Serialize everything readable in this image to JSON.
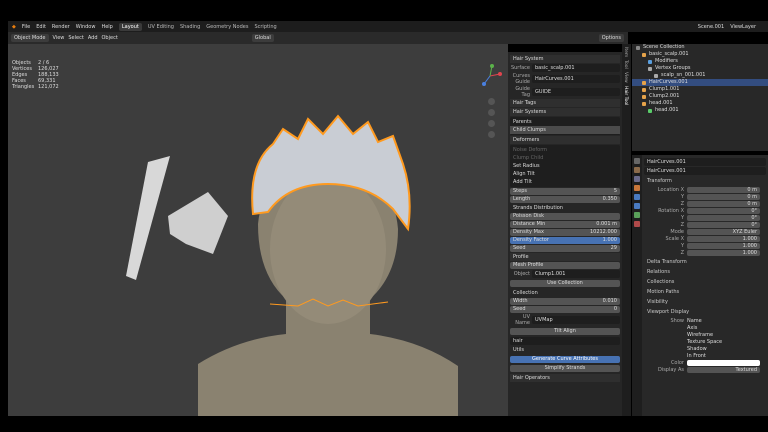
{
  "topbar": {
    "menus": [
      "File",
      "Edit",
      "Render",
      "Window",
      "Help"
    ],
    "workspaces": [
      "Layout",
      "UV Editing",
      "Shading",
      "Geometry Nodes",
      "Scripting"
    ],
    "scene": "Scene.001",
    "view_layer": "ViewLayer"
  },
  "header": {
    "mode": "Object Mode",
    "menus": [
      "View",
      "Select",
      "Add",
      "Object"
    ],
    "orientation": "Global",
    "options": "Options"
  },
  "stats": [
    {
      "k": "Objects",
      "v": "2 / 6"
    },
    {
      "k": "Vertices",
      "v": "126,027"
    },
    {
      "k": "Edges",
      "v": "188,133"
    },
    {
      "k": "Faces",
      "v": "69,331"
    },
    {
      "k": "Triangles",
      "v": "121,072"
    }
  ],
  "hair_panel": {
    "title": "Hair System",
    "surface_label": "Surface",
    "surface_value": "basic_scalp.001",
    "curves_label": "Curves Guide",
    "curves_value": "HairCurves.001",
    "guide_tag_label": "Guide Tag",
    "guide_tag_value": "GUIDE",
    "hair_tags": "Hair Tags",
    "hair_systems": "Hair Systems",
    "systems": [
      "Parents",
      "Child Clumps"
    ],
    "deformers": "Deformers",
    "deformer_items": [
      "Noise Deform",
      "Clump Child",
      "Set Radius",
      "Align Tilt",
      "Add Tilt"
    ],
    "steps_label": "Steps",
    "steps_value": "5",
    "length_label": "Length",
    "length_value": "0.350",
    "strands_distribution": "Strands Distribution",
    "poisson": "Poisson Disk",
    "distance_min_label": "Distance Min",
    "distance_min_value": "0.001 m",
    "density_max_label": "Density Max",
    "density_max_value": "10212.000",
    "density_factor_label": "Density Factor",
    "density_factor_value": "1.000",
    "seed_label": "Seed",
    "seed_value": "29",
    "profile": "Profile",
    "mesh_profile": "Mesh Profile",
    "object_label": "Object",
    "object_value": "Clump1.001",
    "use_collection": "Use Collection",
    "collection_label": "Collection",
    "width_label": "Width",
    "width_value": "0.010",
    "seed2_value": "0",
    "uv_name_label": "UV Name",
    "uv_name_value": "UVMap",
    "tilt_align": "Tilt Align",
    "hair_value": "hair",
    "utils": "Utils",
    "generate": "Generate Curve Attributes",
    "simplify": "Simplify Strands",
    "hair_operators": "Hair Operators"
  },
  "side_tabs": [
    "Item",
    "Tool",
    "View",
    "Hair Tool"
  ],
  "outliner": {
    "items": [
      {
        "label": "Scene Collection",
        "indent": 0,
        "color": "#888888",
        "sel": false
      },
      {
        "label": "basic_scalp.001",
        "indent": 1,
        "color": "#e6a34a",
        "sel": false
      },
      {
        "label": "Modifiers",
        "indent": 2,
        "color": "#5aa0e0",
        "sel": false
      },
      {
        "label": "Vertex Groups",
        "indent": 2,
        "color": "#aaaaaa",
        "sel": false
      },
      {
        "label": "scalp_sn_001.001",
        "indent": 3,
        "color": "#aaaaaa",
        "sel": false
      },
      {
        "label": "HairCurves.001",
        "indent": 1,
        "color": "#e6a34a",
        "sel": true
      },
      {
        "label": "Clump1.001",
        "indent": 1,
        "color": "#e6a34a",
        "sel": false
      },
      {
        "label": "Clump2.001",
        "indent": 1,
        "color": "#e6a34a",
        "sel": false
      },
      {
        "label": "head.001",
        "indent": 1,
        "color": "#e6a34a",
        "sel": false
      },
      {
        "label": "head.001",
        "indent": 2,
        "color": "#5acc6a",
        "sel": false
      }
    ]
  },
  "properties": {
    "object_name": "HairCurves.001",
    "object_name2": "HairCurves.001",
    "transform": "Transform",
    "location_x_label": "Location X",
    "location_x": "0 m",
    "y_label": "Y",
    "location_y": "0 m",
    "z_label": "Z",
    "location_z": "0 m",
    "rotation_x_label": "Rotation X",
    "rotation_x": "0°",
    "rotation_y": "0°",
    "rotation_z": "0°",
    "mode_label": "Mode",
    "mode_value": "XYZ Euler",
    "scale_x_label": "Scale X",
    "scale_x": "1.000",
    "scale_y": "1.000",
    "scale_z": "1.000",
    "sections": [
      "Delta Transform",
      "Relations",
      "Collections",
      "Motion Paths",
      "Visibility",
      "Viewport Display"
    ],
    "show_label": "Show",
    "show_name": "Name",
    "axis": "Axis",
    "wireframe": "Wireframe",
    "texture_space": "Texture Space",
    "shadow": "Shadow",
    "in_front": "In Front",
    "color_label": "Color",
    "display_as_label": "Display As",
    "display_as_value": "Textured"
  }
}
